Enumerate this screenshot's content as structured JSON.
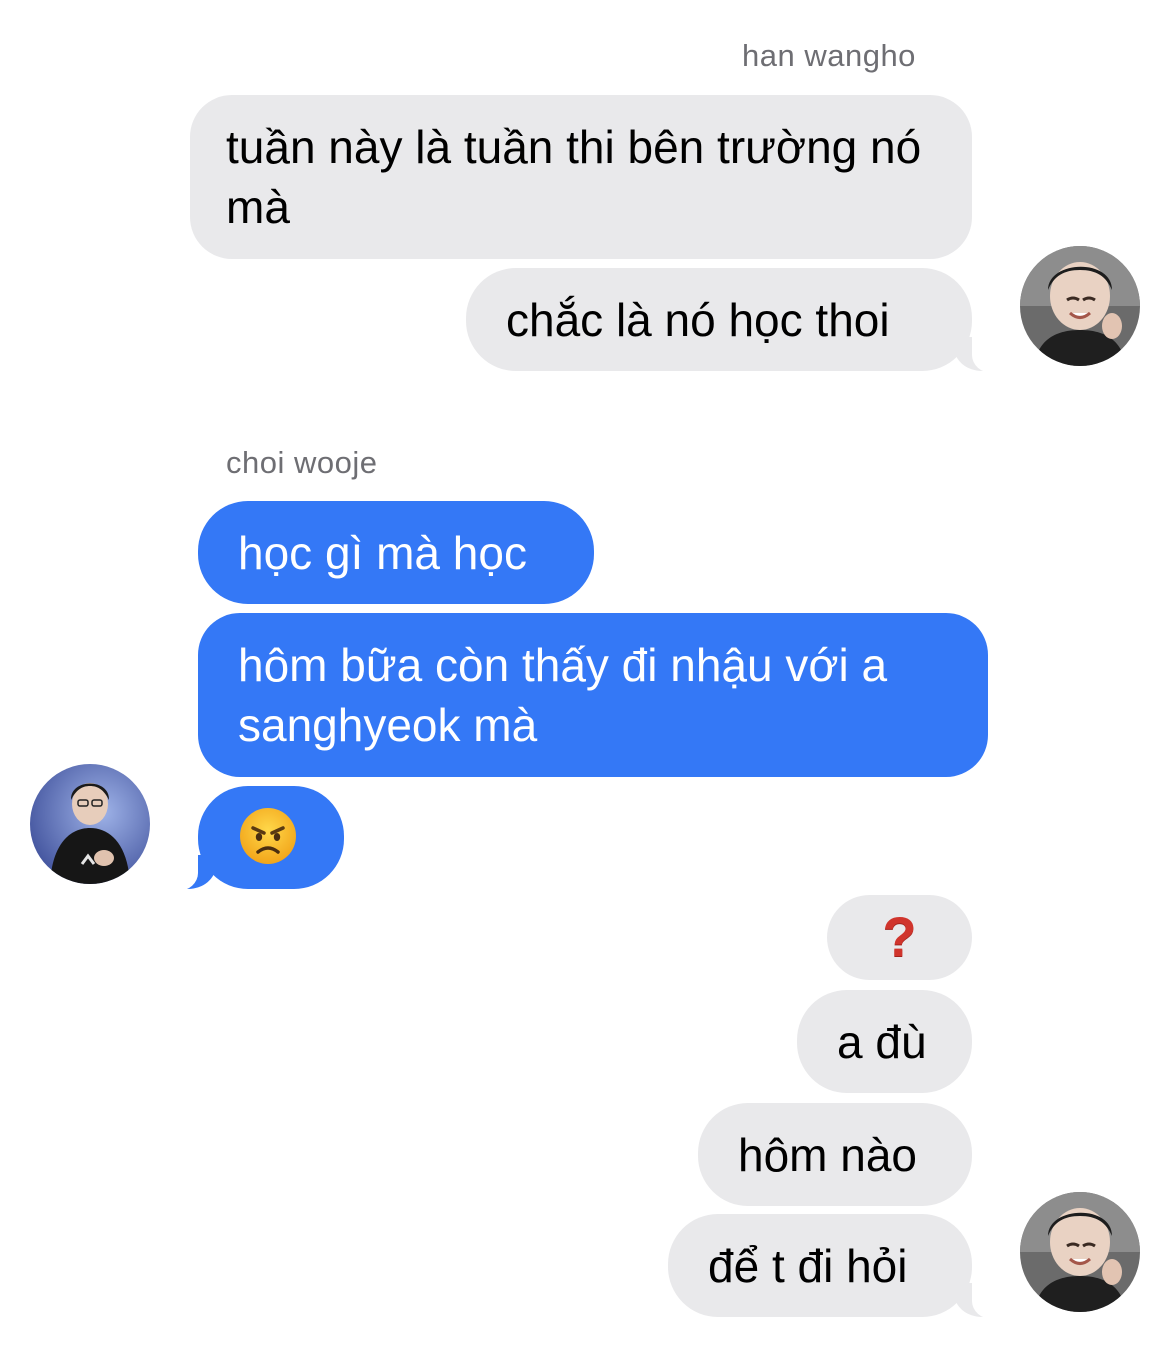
{
  "conversation": {
    "groups": [
      {
        "sender": "han wangho",
        "messages": [
          "tuần này là tuần thi bên trường nó mà",
          "chắc là nó học thoi"
        ],
        "avatar_icon": "person-photo-avatar"
      },
      {
        "sender": "choi wooje",
        "messages": [
          "học gì mà học",
          "hôm bữa còn thấy đi nhậu với a sanghyeok mà",
          "😠"
        ],
        "avatar_icon": "person-photo-avatar"
      },
      {
        "sender": "",
        "messages": [
          "❓",
          "a đù",
          "hôm nào",
          "để t đi hỏi"
        ],
        "avatar_icon": "person-photo-avatar"
      }
    ]
  },
  "colors": {
    "incoming_gray_bubble": "#e9e9eb",
    "outgoing_blue_bubble": "#3478f6",
    "sender_label": "#6e6e73",
    "question_mark": "#d0342c"
  }
}
